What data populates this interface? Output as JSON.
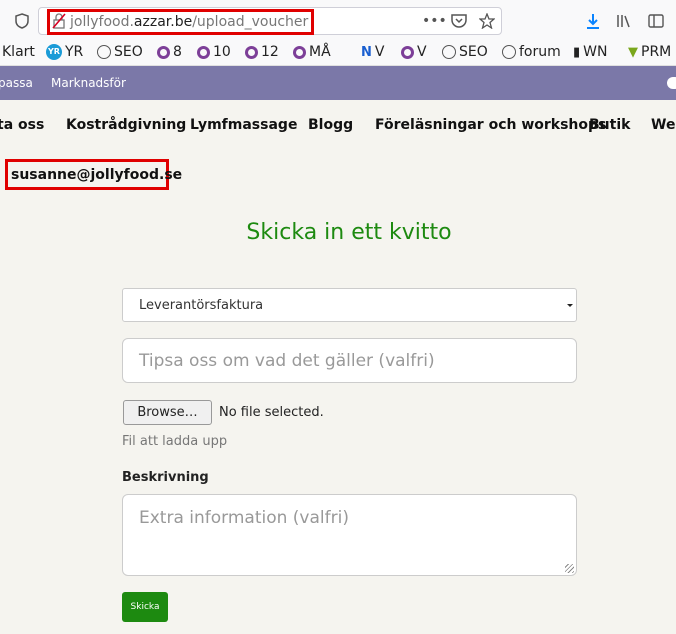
{
  "browser": {
    "url_prefix": "jollyfood.",
    "url_domain": "azzar.be",
    "url_path": "/upload_voucher"
  },
  "bookmarks": [
    {
      "label": "Klart",
      "icon": "none"
    },
    {
      "label": "YR",
      "icon": "yr-icon"
    },
    {
      "label": "SEO",
      "icon": "globe-icon"
    },
    {
      "label": "8",
      "icon": "ring-icon"
    },
    {
      "label": "10",
      "icon": "ring-icon"
    },
    {
      "label": "12",
      "icon": "ring-icon"
    },
    {
      "label": "MÅ",
      "icon": "ring-icon"
    },
    {
      "label": "V",
      "icon": "nv-icon"
    },
    {
      "label": "V",
      "icon": "ring-icon"
    },
    {
      "label": "SEO",
      "icon": "globe-icon"
    },
    {
      "label": "forum",
      "icon": "globe-icon"
    },
    {
      "label": "WN",
      "icon": "wn-icon"
    },
    {
      "label": "PRM",
      "icon": "prm-icon"
    }
  ],
  "adminbar": {
    "items": [
      "passa",
      "Marknadsför"
    ]
  },
  "nav": {
    "items": [
      "ta oss",
      "Kostrådgivning",
      "Lymfmassage",
      "Blogg",
      "Föreläsningar och workshops",
      "Butik",
      "Web"
    ]
  },
  "user": {
    "email": "susanne@jollyfood.se"
  },
  "page": {
    "title": "Skicka in ett kvitto"
  },
  "form": {
    "type_select": {
      "value": "Leverantörsfaktura"
    },
    "tip_input": {
      "placeholder": "Tipsa oss om vad det gäller (valfri)"
    },
    "file": {
      "browse_label": "Browse…",
      "status": "No file selected.",
      "label": "Fil att ladda upp"
    },
    "description": {
      "label": "Beskrivning",
      "placeholder": "Extra information (valfri)"
    },
    "submit_label": "Skicka"
  },
  "colors": {
    "accent": "#1d8a10",
    "admin_bar": "#7b78a8",
    "highlight": "#e00000"
  }
}
